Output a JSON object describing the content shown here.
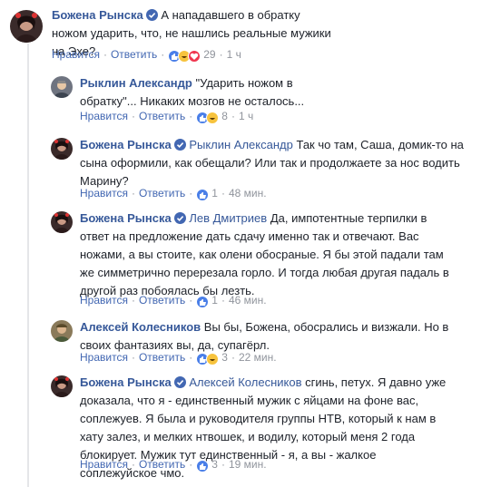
{
  "labels": {
    "like": "Нравится",
    "reply": "Ответить",
    "sep": "·"
  },
  "colors": {
    "link": "#365899",
    "meta": "#90949c"
  },
  "comments": [
    {
      "author": "Божена Рынска",
      "verified": true,
      "mention": "",
      "text": "А нападавшего в обратку ножом ударить, что, не нашлись реальные мужики на Эхе?",
      "reactions": [
        "like",
        "haha",
        "love"
      ],
      "reaction_count": "29",
      "time": "1 ч"
    },
    {
      "author": "Рыклин Александр",
      "verified": false,
      "mention": "",
      "text": "\"Ударить ножом в обратку\"... Никаких мозгов не осталось...",
      "reactions": [
        "like",
        "haha"
      ],
      "reaction_count": "8",
      "time": "1 ч"
    },
    {
      "author": "Божена Рынска",
      "verified": true,
      "mention": "Рыклин Александр",
      "text": "Так чо там, Саша, домик-то на сына оформили, как обещали? Или так и продолжаете за нос водить Марину?",
      "reactions": [
        "like"
      ],
      "reaction_count": "1",
      "time": "48 мин."
    },
    {
      "author": "Божена Рынска",
      "verified": true,
      "mention": "Лев Дмитриев",
      "text": "Да, импотентные терпилки в ответ на предложение дать сдачу именно так и отвечают. Вас ножами, а вы стоите, как олени обосраные. Я бы этой падали там же симметрично перерезала горло. И тогда любая другая падаль в другой раз побоялась бы лезть.",
      "reactions": [
        "like"
      ],
      "reaction_count": "1",
      "time": "46 мин."
    },
    {
      "author": "Алексей Колесников",
      "verified": false,
      "mention": "",
      "text": "Вы бы, Божена, обосрались и визжали. Но в своих фантазиях вы, да, супагёрл.",
      "reactions": [
        "like",
        "haha"
      ],
      "reaction_count": "3",
      "time": "22 мин."
    },
    {
      "author": "Божена Рынска",
      "verified": true,
      "mention": "Алексей Колесников",
      "text": "сгинь, петух. Я давно уже доказала, что я - единственный мужик с яйцами на фоне вас, соплежуев. Я была и руководителя группы НТВ, который к нам в хату залез, и мелких нтвошек, и водилу, который меня 2 года блокирует. Мужик тут единственный - я, а вы - жалкое соплежуйское чмо.",
      "reactions": [
        "like"
      ],
      "reaction_count": "3",
      "time": "19 мин."
    }
  ]
}
